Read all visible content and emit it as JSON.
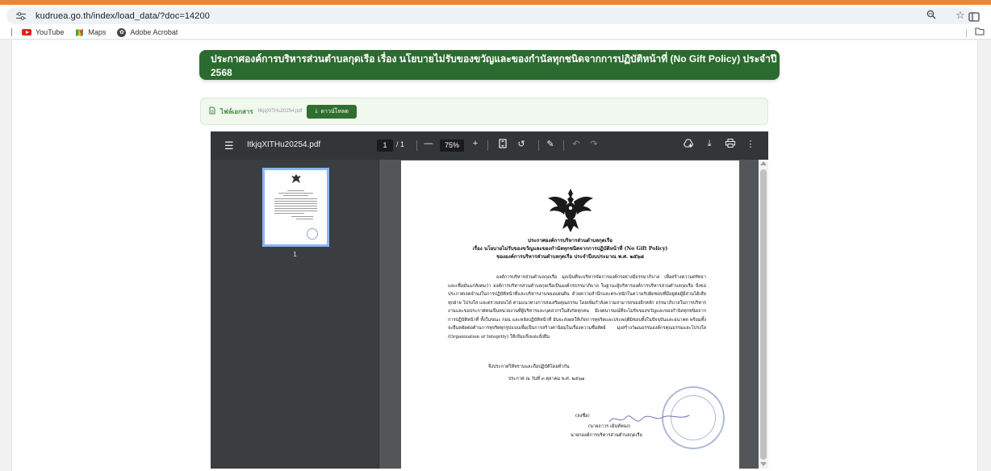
{
  "browser": {
    "url": "kudruea.go.th/index/load_data/?doc=14200",
    "bookmarks": [
      {
        "label": "YouTube",
        "icon": "youtube-icon"
      },
      {
        "label": "Maps",
        "icon": "maps-icon"
      },
      {
        "label": "Adobe Acrobat",
        "icon": "acrobat-icon"
      }
    ]
  },
  "page": {
    "title": "ประกาศองค์การบริหารส่วนตำบลกุดเรือ เรื่อง นโยบายไม่รับของขวัญและของกำนัลทุกชนิดจากการปฏิบัติหน้าที่ (No Gift Policy) ประจำปี 2568",
    "file_label": "ไฟล์เอกสาร",
    "file_name": "ItkjqXITHu20254.pdf",
    "download_label": "ดาวน์โหลด"
  },
  "viewer": {
    "doc_title": "ItkjqXITHu20254.pdf",
    "current_page": "1",
    "page_sep": "/ 1",
    "zoom": "75%",
    "thumb_page_number": "1"
  },
  "document": {
    "heading_1": "ประกาศองค์การบริหารส่วนตำบลกุดเรือ",
    "heading_2": "เรื่อง  นโยบายไม่รับของขวัญและของกำนัลทุกชนิดจากการปฏิบัติหน้าที่ (No Gift Policy)",
    "heading_3": "ขององค์การบริหารส่วนตำบลกุดเรือ ประจำปีงบประมาณ พ.ศ. ๒๕๖๘",
    "paragraph": "องค์การบริหารส่วนตำบลกุดเรือ มุ่งเน้นที่จะบริหารจัดการองค์กรอย่างมีธรรมาภิบาล เพื่อสร้างความศรัทธาและเชื่อมั่นแก่สังคมว่า องค์การบริหารส่วนตำบลกุดเรือเป็นองค์กรธรรมาภิบาล ในฐานะผู้บริหารองค์การบริหารส่วนตำบลกุดเรือ จึงขอประกาศเจตจำนงในการปฏิบัติหน้าที่และบริหารงานของแผ่นดิน ด้วยความสำนึกและตระหนักในความรับผิดชอบที่มีอยู่ต่อผู้มีส่วนได้เสียทุกฝ่าย โปร่งใส และตรวจสอบได้ ตามแนวทางการส่งเสริมคุณธรรม โดยเพิ่มกำลังความสามารถของอีกหลัก ธรรมาภิบาลในการบริหารงานและขอประกาศตนเป็นหน่วยงานที่ผู้บริหารและบุคลากรในสังกัดทุกคน มีเจตนารมณ์ที่จะไม่รับของขวัญและของกำนัลทุกชนิดจากการปฏิบัติหน้าที่ ทั้งในขณะ ก่อน และหลังปฏิบัติหน้าที่ อันจะส่งผลให้เกิดการทุจริตและประพฤติมิชอบทั้งในปัจจุบันและอนาคต พร้อมทั้งจะยืนหยัดต่อต้านการทุจริตทุกรูปแบบเพื่อเป็นการสร้างค่านิยมในเรื่องความซื่อสัตย์ มุ่งสร้างวัฒนธรรมองค์กรคุณธรรมและโปร่งใส (Organization of Integrity) ให้เข้มแข็งและยั่งยืน",
    "closing_1": "จึงประกาศให้ทราบและถือปฏิบัติโดยทั่วกัน",
    "closing_2": "ประกาศ ณ วันที่  ๓   ตุลาคม พ.ศ. ๒๕๖๗",
    "sign_label": "(ลงชื่อ)",
    "sign_name": "(นายถาวร  เม้นท์ทอง)",
    "sign_position": "นายกองค์การบริหารส่วนตำบลกุดเรือ"
  }
}
